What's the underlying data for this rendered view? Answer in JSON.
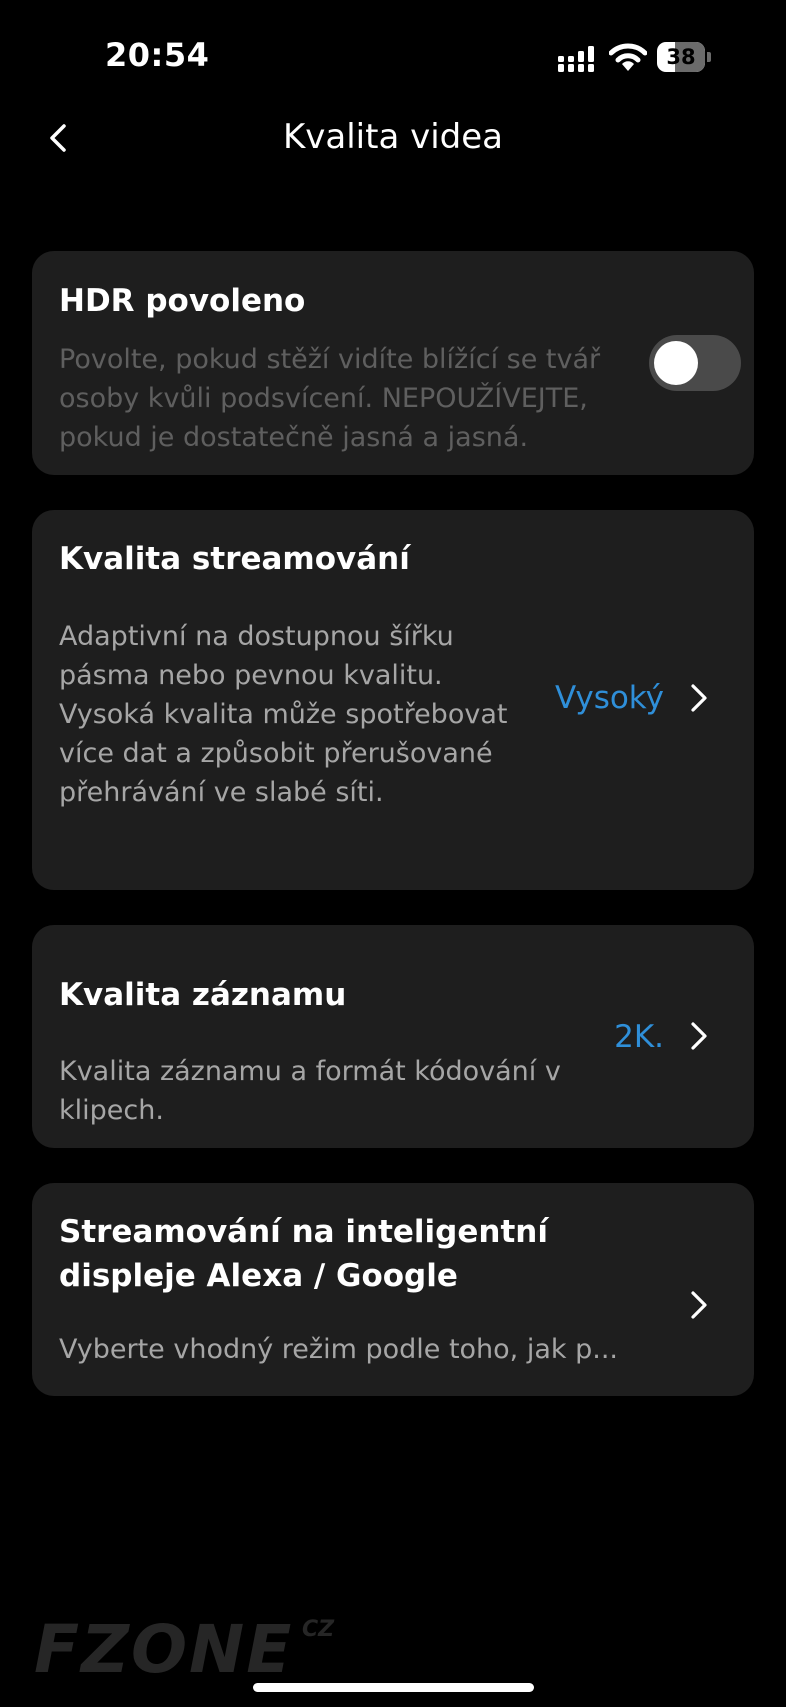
{
  "status_bar": {
    "time": "20:54",
    "battery_level": "38"
  },
  "header": {
    "title": "Kvalita videa"
  },
  "settings": {
    "hdr": {
      "title": "HDR povoleno",
      "description": "Povolte, pokud stěží vidíte blížící se tvář osoby kvůli podsvícení. NEPOUŽÍVEJTE, pokud je dostatečně jasná a jasná.",
      "enabled": false
    },
    "streaming_quality": {
      "title": "Kvalita streamování",
      "description": "Adaptivní na dostupnou šířku pásma nebo pevnou kvalitu. Vysoká kvalita může spotřebovat více dat a způsobit přerušované přehrávání ve slabé síti.",
      "value": "Vysoký"
    },
    "recording_quality": {
      "title": "Kvalita záznamu",
      "description": "Kvalita záznamu a formát kódování v klipech.",
      "value": "2K."
    },
    "smart_display": {
      "title": "Streamování na inteligentní displeje Alexa / Google",
      "description": "Vyberte vhodný režim podle toho, jak p..."
    }
  },
  "watermark": {
    "text": "FZONE",
    "suffix": "CZ"
  },
  "colors": {
    "accent": "#2f8fd9",
    "card": "#1e1e1e",
    "background": "#000000"
  }
}
